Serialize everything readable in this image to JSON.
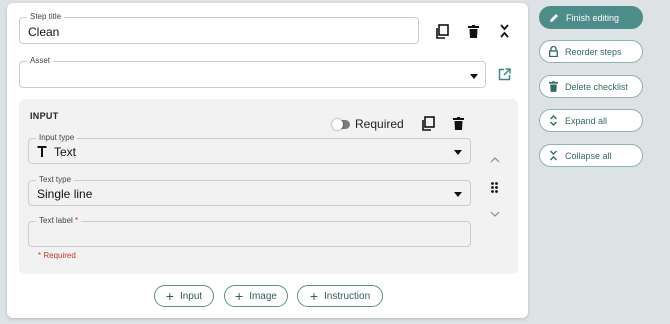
{
  "step": {
    "title_label": "Step title",
    "title_value": "Clean",
    "asset_label": "Asset",
    "asset_value": ""
  },
  "input_section": {
    "heading": "INPUT",
    "required_label": "Required",
    "input_type_label": "Input type",
    "input_type_value": "Text",
    "text_type_label": "Text type",
    "text_type_value": "Single line",
    "text_label_label": "Text label",
    "text_label_required_mark": "*",
    "text_label_value": "",
    "required_hint": "* Required"
  },
  "add_buttons": {
    "input": "Input",
    "image": "Image",
    "instruction": "Instruction"
  },
  "sidebar": {
    "finish_editing": "Finish editing",
    "reorder_steps": "Reorder steps",
    "delete_checklist": "Delete checklist",
    "expand_all": "Expand all",
    "collapse_all": "Collapse all"
  },
  "colors": {
    "accent": "#4c8d89",
    "accent_text": "#2f6c67",
    "required_red": "#c0392b",
    "background": "#dde3e5",
    "section_gray": "#f2f2f2"
  },
  "icons": [
    "copy-icon",
    "trash-icon",
    "collapse-icon",
    "dropdown-caret-icon",
    "open-external-icon",
    "text-type-icon",
    "chevron-up-icon",
    "drag-handle-icon",
    "chevron-down-icon",
    "plus-icon",
    "pencil-icon",
    "lock-icon",
    "expand-icon"
  ]
}
